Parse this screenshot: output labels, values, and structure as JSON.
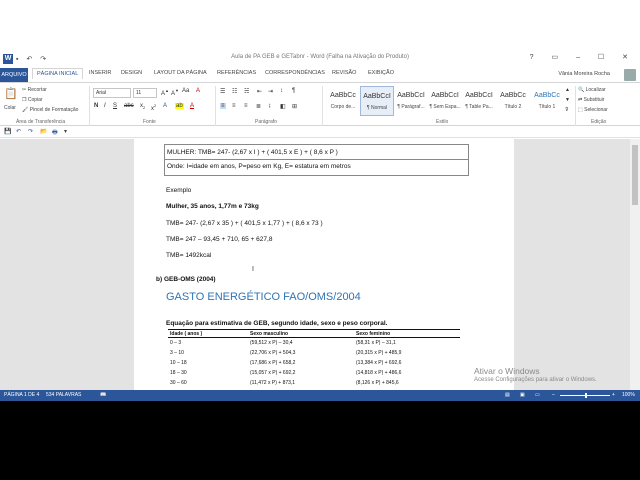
{
  "window": {
    "title": "Aula de PA GEB e GETabnr - Word (Falha na Ativação do Produto)",
    "controls": "? ▭ – ☐ ✕"
  },
  "tabs": {
    "file": "ARQUIVO",
    "items": [
      "PÁGINA INICIAL",
      "INSERIR",
      "DESIGN",
      "LAYOUT DA PÁGINA",
      "REFERÊNCIAS",
      "CORRESPONDÊNCIAS",
      "REVISÃO",
      "EXIBIÇÃO"
    ],
    "user": "Vânia Moreira Rocha"
  },
  "ribbon": {
    "clipboard": {
      "paste": "Colar",
      "cut": "Recortar",
      "copy": "Copiar",
      "format_painter": "Pincel de Formatação",
      "label": "Área de Transferência"
    },
    "font": {
      "name": "Arial",
      "size": "11",
      "label": "Fonte"
    },
    "paragraph": {
      "label": "Parágrafo"
    },
    "styles": {
      "label": "Estilo",
      "items": [
        {
          "sample": "AaBbCc",
          "name": "Corpo de...",
          "selected": false,
          "blue": false
        },
        {
          "sample": "AaBbCcI",
          "name": "¶ Normal",
          "selected": true,
          "blue": false
        },
        {
          "sample": "AaBbCcI",
          "name": "¶ Parágraf...",
          "selected": false,
          "blue": false
        },
        {
          "sample": "AaBbCcI",
          "name": "¶ Sem Espa...",
          "selected": false,
          "blue": false
        },
        {
          "sample": "AaBbCcI",
          "name": "¶ Table Pa...",
          "selected": false,
          "blue": false
        },
        {
          "sample": "AaBbCc",
          "name": "Título 2",
          "selected": false,
          "blue": false
        },
        {
          "sample": "AaBbCc",
          "name": "Título 1",
          "selected": false,
          "blue": true
        }
      ]
    },
    "editing": {
      "find": "Localizar",
      "replace": "Substituir",
      "select": "Selecionar",
      "label": "Edição"
    }
  },
  "document": {
    "formula_woman": "MULHER: TMB= 247- (2,67 x I ) + ( 401,5 x E ) + ( 8,6 x P )",
    "legend": "Onde: I=idade em anos, P=peso em Kg, E= estatura em metros",
    "example_label": "Exemplo",
    "example_case": "Mulher, 35 anos, 1,77m e 73kg",
    "calc1": "TMB= 247- (2,67 x 35 ) + ( 401,5 x 1,77 ) + ( 8,6 x 73 )",
    "calc2": "TMB= 247 – 93,45 + 710, 65 + 627,8",
    "calc3": "TMB= 1492kcal",
    "section_b": "b) GEB-OMS (2004)",
    "heading": "GASTO ENERGÉTICO FAO/OMS/2004",
    "table_caption": "Equação para estimativa de GEB, segundo idade, sexo e peso corporal.",
    "table": {
      "headers": [
        "Idade ( anos )",
        "Sexo masculino",
        "Sexo feminino"
      ],
      "rows": [
        [
          "0 – 3",
          "(59,512 x P) – 30,4",
          "(58,31 x P) – 31,1"
        ],
        [
          "3 – 10",
          "(22,706 x P) + 504,3",
          "(20,315 x P) + 485,9"
        ],
        [
          "10 – 18",
          "(17,686 x P) + 658,2",
          "(13,384 x P) + 692,6"
        ],
        [
          "18 – 30",
          "(15,057 x P) + 692,2",
          "(14,818 x P) + 486,6"
        ],
        [
          "30 – 60",
          "(11,472 x P) + 873,1",
          "(8,126 x P) + 845,6"
        ]
      ]
    }
  },
  "watermark": {
    "line1": "Ativar o Windows",
    "line2": "Acesse Configurações para ativar o Windows."
  },
  "status": {
    "page": "PÁGINA 1 DE 4",
    "words": "534 PALAVRAS",
    "zoom": "100%"
  }
}
